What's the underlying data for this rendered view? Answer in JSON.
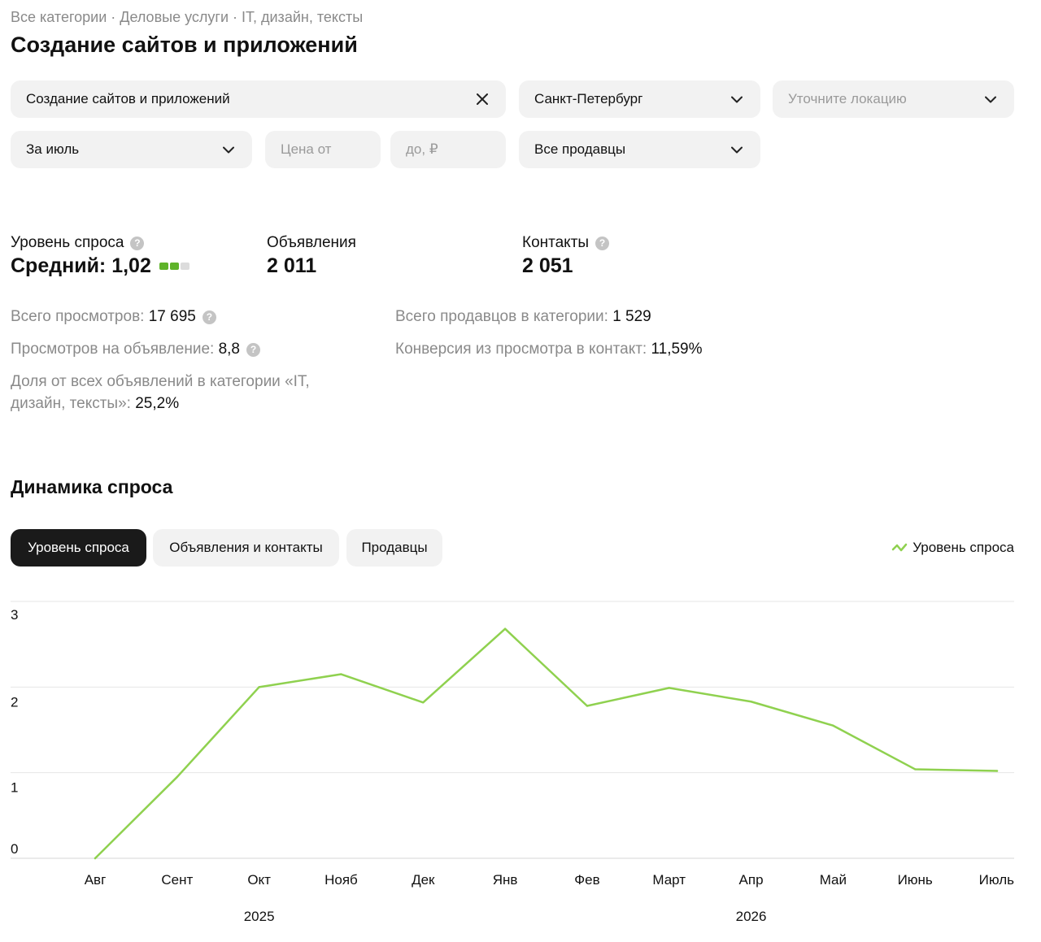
{
  "breadcrumb": "Все категории · Деловые услуги · IT, дизайн, тексты",
  "page_title": "Создание сайтов и приложений",
  "filters": {
    "category": {
      "value": "Создание сайтов и приложений",
      "icon": "close-icon"
    },
    "city": {
      "value": "Санкт-Петербург",
      "icon": "chevron-down-icon"
    },
    "location": {
      "placeholder": "Уточните локацию",
      "icon": "chevron-down-icon"
    },
    "period": {
      "value": "За июль",
      "icon": "chevron-down-icon"
    },
    "price_from": {
      "placeholder": "Цена от"
    },
    "price_to": {
      "placeholder": "до, ₽"
    },
    "sellers": {
      "value": "Все продавцы",
      "icon": "chevron-down-icon"
    }
  },
  "metrics": {
    "demand": {
      "label": "Уровень спроса",
      "value": "Средний: 1,02",
      "level": 2,
      "level_max": 3
    },
    "ads": {
      "label": "Объявления",
      "value": "2 011"
    },
    "contacts": {
      "label": "Контакты",
      "value": "2 051"
    }
  },
  "stats": {
    "total_views": {
      "label": "Всего просмотров:",
      "value": "17 695"
    },
    "views_per_ad": {
      "label": "Просмотров на объявление:",
      "value": "8,8"
    },
    "share": {
      "label": "Доля от всех объявлений в категории «IT, дизайн, тексты»:",
      "value": "25,2%"
    },
    "total_sellers": {
      "label": "Всего продавцов в категории:",
      "value": "1 529"
    },
    "conversion": {
      "label": "Конверсия из просмотра в контакт:",
      "value": "11,59%"
    }
  },
  "dynamics": {
    "title": "Динамика спроса",
    "tabs": [
      {
        "label": "Уровень спроса",
        "active": true
      },
      {
        "label": "Объявления и контакты",
        "active": false
      },
      {
        "label": "Продавцы",
        "active": false
      }
    ],
    "legend_label": "Уровень спроса"
  },
  "colors": {
    "accent_green": "#8fd14f",
    "level_active": "#5fb32a",
    "level_inactive": "#dcdcdc",
    "tab_active_bg": "#1a1a1a"
  },
  "chart_data": {
    "type": "line",
    "categories": [
      "Авг",
      "Сент",
      "Окт",
      "Нояб",
      "Дек",
      "Янв",
      "Фев",
      "Март",
      "Апр",
      "Май",
      "Июнь",
      "Июль"
    ],
    "year_labels": [
      {
        "label": "2025",
        "category": "Окт"
      },
      {
        "label": "2026",
        "category": "Апр"
      }
    ],
    "series": [
      {
        "name": "Уровень спроса",
        "values": [
          0.0,
          0.95,
          2.0,
          2.15,
          1.82,
          2.68,
          1.78,
          1.99,
          1.83,
          1.55,
          1.04,
          1.02
        ]
      }
    ],
    "y_ticks": [
      0,
      1,
      2,
      3
    ],
    "ylim": [
      0,
      3
    ],
    "grid": true,
    "legend_position": "top-right"
  }
}
